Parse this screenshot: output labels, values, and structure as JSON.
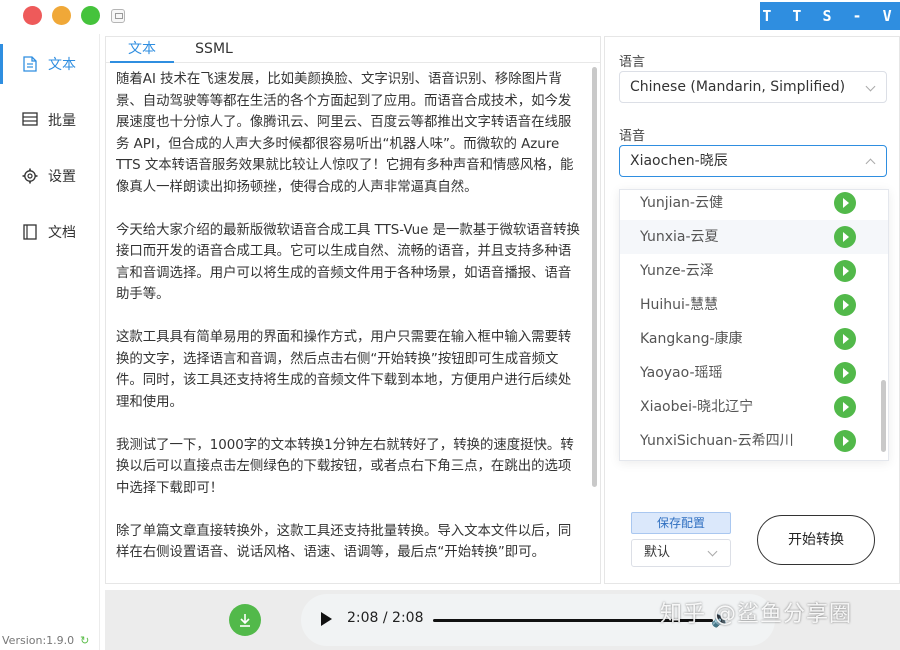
{
  "window": {
    "brand": "T T S - V U E"
  },
  "sidebar": {
    "items": [
      {
        "label": "文本",
        "icon": "document-icon"
      },
      {
        "label": "批量",
        "icon": "list-icon"
      },
      {
        "label": "设置",
        "icon": "gear-icon"
      },
      {
        "label": "文档",
        "icon": "book-icon"
      }
    ],
    "version": "Version:1.9.0"
  },
  "editor": {
    "tabs": [
      "文本",
      "SSML"
    ],
    "paragraphs": [
      "随着AI 技术在飞速发展，比如美颜换脸、文字识别、语音识别、移除图片背景、自动驾驶等等都在生活的各个方面起到了应用。而语音合成技术，如今发展速度也十分惊人了。像腾讯云、阿里云、百度云等都推出文字转语音在线服务 API，但合成的人声大多时候都很容易听出“机器人味”。而微软的 Azure TTS 文本转语音服务效果就比较让人惊叹了！它拥有多种声音和情感风格，能像真人一样朗读出抑扬顿挫，使得合成的人声非常逼真自然。",
      "今天给大家介绍的最新版微软语音合成工具 TTS-Vue 是一款基于微软语音转换接口而开发的语音合成工具。它可以生成自然、流畅的语音，并且支持多种语言和音调选择。用户可以将生成的音频文件用于各种场景，如语音播报、语音助手等。",
      "这款工具具有简单易用的界面和操作方式，用户只需要在输入框中输入需要转换的文字，选择语言和音调，然后点击右侧“开始转换”按钮即可生成音频文件。同时，该工具还支持将生成的音频文件下载到本地，方便用户进行后续处理和使用。",
      "我测试了一下，1000字的文本转换1分钟左右就转好了，转换的速度挺快。转换以后可以直接点击左侧绿色的下载按钮，或者点右下角三点，在跳出的选项中选择下载即可！",
      "除了单篇文章直接转换外，这款工具还支持批量转换。导入文本文件以后，同样在右侧设置语音、说话风格、语速、语调等，最后点“开始转换”即可。"
    ]
  },
  "player": {
    "time": "2:08 / 2:08",
    "progress": 1.0
  },
  "settings": {
    "language_label": "语言",
    "language_value": "Chinese (Mandarin, Simplified)",
    "voice_label": "语音",
    "voice_value": "Xiaochen-晓辰",
    "voice_options": [
      "Yunjian-云健",
      "Yunxia-云夏",
      "Yunze-云泽",
      "Huihui-慧慧",
      "Kangkang-康康",
      "Yaoyao-瑶瑶",
      "Xiaobei-晓北辽宁",
      "YunxiSichuan-云希四川"
    ],
    "save_label": "保存配置",
    "preset_value": "默认",
    "start_label": "开始转换"
  },
  "watermark": "知乎 @鲨鱼分享圈",
  "colors": {
    "accent": "#2f8ee0",
    "green": "#52b94a",
    "brand_bg": "#2f8ee0"
  }
}
